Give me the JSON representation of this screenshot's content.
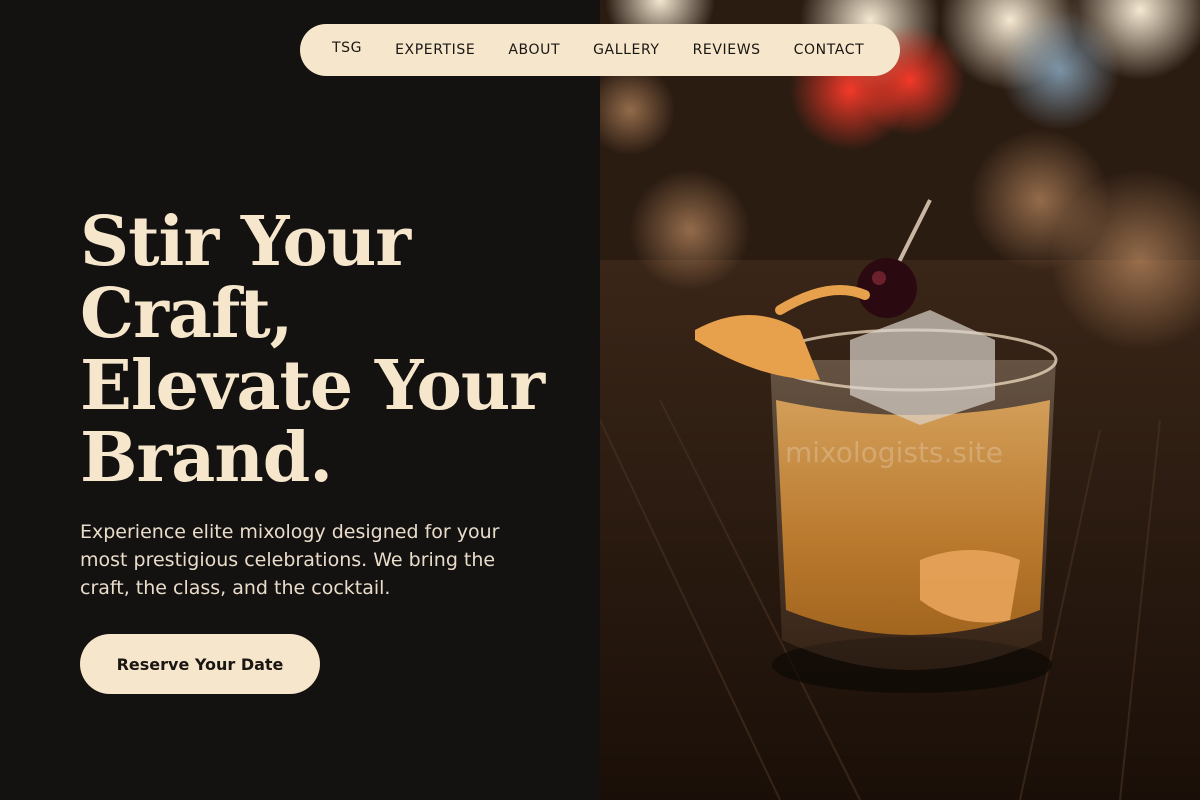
{
  "nav": {
    "brand": "TSG",
    "items": [
      "EXPERTISE",
      "ABOUT",
      "GALLERY",
      "REVIEWS",
      "CONTACT"
    ]
  },
  "hero": {
    "title_lines": [
      "Stir Your",
      "Craft,",
      "Elevate Your",
      "Brand."
    ],
    "subtitle": "Experience elite mixology designed for your most prestigious celebrations. We bring the craft, the class, and the cocktail.",
    "cta_label": "Reserve Your Date"
  },
  "photo": {
    "subject": "old-fashioned-cocktail-photo",
    "watermark": "mixologists.site"
  },
  "colors": {
    "background": "#141210",
    "accent_cream": "#f5e6cc",
    "text_dark": "#1a1612"
  }
}
